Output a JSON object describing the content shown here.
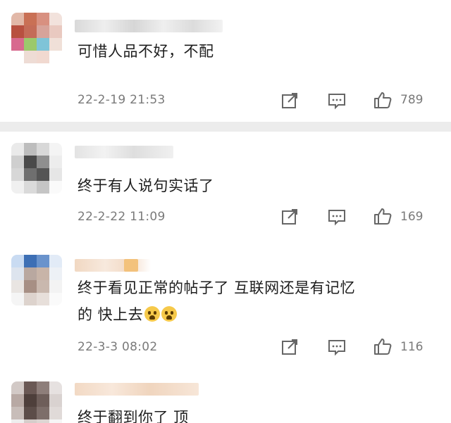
{
  "comments": [
    {
      "text": "可惜人品不好，不配",
      "time": "22-2-19 21:53",
      "likes": "789"
    },
    {
      "text": "终于有人说句实话了",
      "time": "22-2-22 11:09",
      "likes": "169"
    },
    {
      "text_line1": "终于看见正常的帖子了 互联网还是有记忆",
      "text_line2": "的 快上去",
      "time": "22-3-3 08:02",
      "likes": "116"
    },
    {
      "text": "终于翻到你了 顶"
    }
  ],
  "icons": {
    "share": "share-icon",
    "comment": "comment-icon",
    "like": "thumbs-up-icon",
    "emoji": "fearful-face-emoji"
  },
  "colors": {
    "meta": "#7a7a7a",
    "divider": "#ececec"
  }
}
